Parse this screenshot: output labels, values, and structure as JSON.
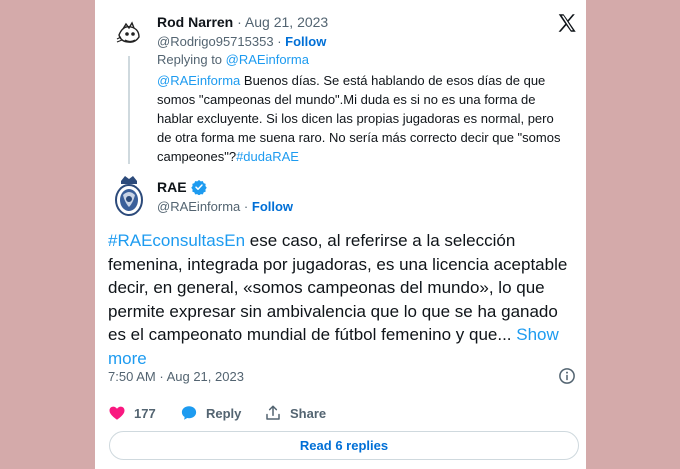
{
  "reply_tweet": {
    "author_name": "Rod Narren",
    "separator": "·",
    "date": "Aug 21, 2023",
    "handle": "@Rodrigo95715353",
    "follow_label": "Follow",
    "replying_prefix": "Replying to ",
    "replying_handle": "@RAEinforma",
    "mention": "@RAEinforma",
    "body": " Buenos días. Se está hablando de esos días de que somos \"campeonas del mundo\".Mi duda es si no es una forma de hablar excluyente. Si los dicen las propias jugadoras es normal, pero de otra forma me suena raro. No sería más correcto decir que \"somos campeones\"?",
    "hashtag": "#dudaRAE"
  },
  "main_tweet": {
    "author_name": "RAE",
    "handle": "@RAEinforma",
    "separator": "·",
    "follow_label": "Follow",
    "hashtag": "#RAEconsultasEn",
    "body": " ese caso, al referirse a la selección femenina, integrada por jugadoras, es una licencia aceptable decir, en general, «somos campeonas del mundo», lo que permite expresar sin ambivalencia que lo que se ha ganado es el campeonato mundial de fútbol femenino y que... ",
    "show_more": "Show more",
    "time": "7:50 AM",
    "date": "Aug 21, 2023",
    "likes": "177",
    "reply_label": "Reply",
    "share_label": "Share",
    "read_replies": "Read 6 replies"
  },
  "colors": {
    "accent": "#1d9bf0",
    "follow": "#006fd6",
    "like": "#f91880",
    "background": "#d4aaaa"
  },
  "icons": [
    "x-logo-icon",
    "verified-badge-icon",
    "info-icon",
    "heart-icon",
    "reply-bubble-icon",
    "share-icon"
  ]
}
